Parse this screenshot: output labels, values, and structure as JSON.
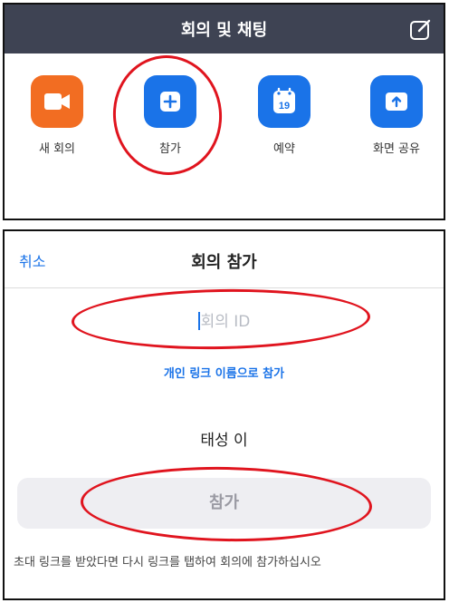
{
  "meeting_screen": {
    "title": "회의 및 채팅",
    "actions": [
      {
        "label": "새 회의",
        "icon": "video-camera-icon",
        "color": "#f26d22"
      },
      {
        "label": "참가",
        "icon": "plus-icon",
        "color": "#1a73e8"
      },
      {
        "label": "예약",
        "icon": "calendar-icon",
        "color": "#1a73e8",
        "calendar_day": "19"
      },
      {
        "label": "화면 공유",
        "icon": "share-screen-icon",
        "color": "#1a73e8"
      }
    ]
  },
  "join_screen": {
    "cancel_label": "취소",
    "title": "회의 참가",
    "meeting_id_placeholder": "회의 ID",
    "personal_link_label": "개인 링크 이름으로 참가",
    "display_name": "태성 이",
    "join_button_label": "참가",
    "hint": "초대 링크를 받았다면 다시 링크를 탭하여 회의에 참가하십시오"
  },
  "colors": {
    "header_bg": "#3e4353",
    "accent_blue": "#1a73e8",
    "accent_orange": "#f26d22",
    "annotation_red": "#e0141e"
  }
}
